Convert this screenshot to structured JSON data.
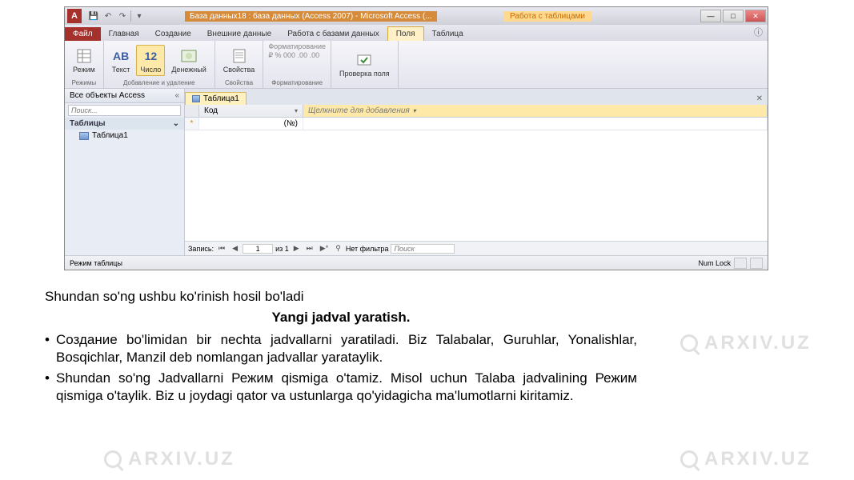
{
  "titlebar": {
    "app_letter": "A",
    "title": "База данных18 : база данных (Access 2007) - Microsoft Access (...",
    "context_title": "Работа с таблицами"
  },
  "qat": {
    "save_icon": "💾",
    "undo_icon": "↶",
    "redo_icon": "↷",
    "dropdown_icon": "▾"
  },
  "window_controls": {
    "min": "—",
    "max": "□",
    "close": "✕"
  },
  "ribbon": {
    "tabs": {
      "file": "Файл",
      "home": "Главная",
      "create": "Создание",
      "external": "Внешние данные",
      "database": "Работа с базами данных",
      "fields": "Поля",
      "table": "Таблица"
    },
    "help_icon": "ⓘ",
    "groups": {
      "views": {
        "label": "Режимы",
        "mode_btn": "Режим"
      },
      "add_delete": {
        "label": "Добавление и удаление",
        "text_btn": "Текст",
        "number_btn": "Число",
        "currency_btn": "Денежный"
      },
      "properties": {
        "label": "Свойства",
        "props_btn": "Свойства"
      },
      "formatting": {
        "label": "Форматирование",
        "row1": "Форматирование",
        "row2": "₽  %  000  .00  .00"
      },
      "validation": {
        "label": "",
        "btn": "Проверка поля"
      }
    }
  },
  "nav": {
    "header": "Все объекты Access",
    "chevron": "«",
    "search_placeholder": "Поиск...",
    "group_tables": "Таблицы",
    "group_chevron": "⌄",
    "item1": "Таблица1"
  },
  "doc_tab": {
    "label": "Таблица1",
    "close": "✕"
  },
  "datasheet": {
    "col_id": "Код",
    "col_add": "Щелкните для добавления",
    "dropdown": "▾",
    "new_row_marker": "*",
    "new_id": "(№)"
  },
  "record_nav": {
    "label": "Запись:",
    "first": "⏮",
    "prev": "◀",
    "position": "1",
    "of_label": "из 1",
    "next": "▶",
    "last": "⏭",
    "new": "▶*",
    "filter_icon": "⚲",
    "filter_label": "Нет фильтра",
    "search_placeholder": "Поиск"
  },
  "statusbar": {
    "left": "Режим таблицы",
    "numlock": "Num Lock"
  },
  "doc": {
    "line1": "Shundan so'ng ushbu ko'rinish hosil bo'ladi",
    "heading": "Yangi jadval yaratish.",
    "b1": "Создание bo'limidan bir nechta jadvallarni yaratiladi. Biz Talabalar, Guruhlar, Yonalishlar, Bosqichlar, Manzil deb nomlangan jadvallar yarataylik.",
    "b2": "Shundan so'ng Jadvallarni Режим qismiga o'tamiz. Misol uchun Talaba jadvalining Режим qismiga o'taylik. Biz u joydagi qator va ustunlarga qo'yidagicha ma'lumotlarni kiritamiz."
  },
  "watermark": "ARXIV.UZ"
}
